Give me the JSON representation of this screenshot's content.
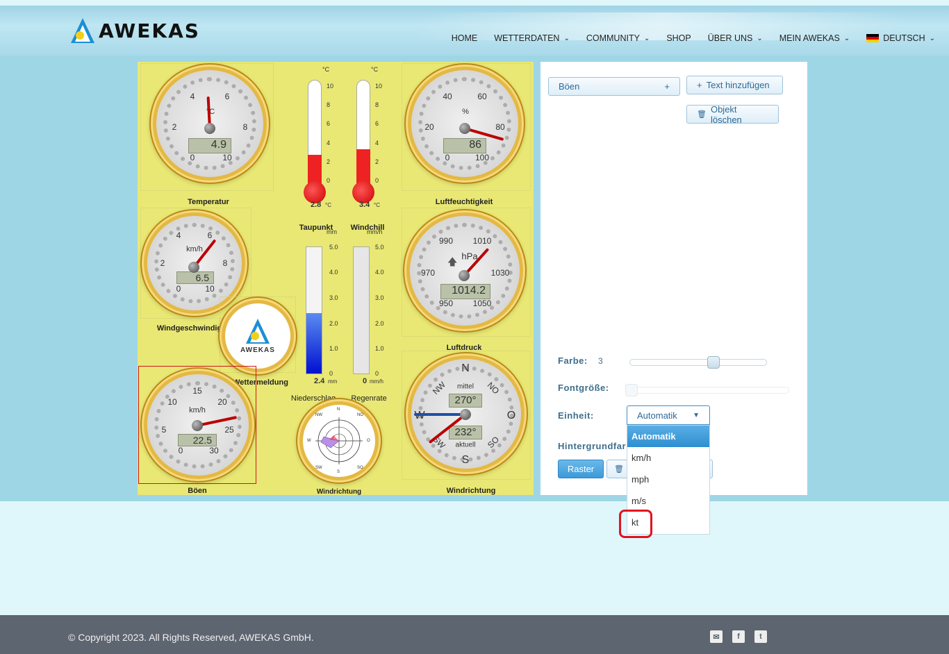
{
  "header": {
    "logo_text": "AWEKAS",
    "nav": [
      {
        "label": "HOME",
        "dropdown": false
      },
      {
        "label": "WETTERDATEN",
        "dropdown": true
      },
      {
        "label": "COMMUNITY",
        "dropdown": true
      },
      {
        "label": "SHOP",
        "dropdown": false
      },
      {
        "label": "ÜBER UNS",
        "dropdown": true
      },
      {
        "label": "MEIN AWEKAS",
        "dropdown": true
      },
      {
        "label": "DEUTSCH",
        "dropdown": true
      }
    ]
  },
  "gauges": {
    "temperatur": {
      "label": "Temperatur",
      "unit": "°C",
      "value": "4.9",
      "scale": [
        "0",
        "2",
        "4",
        "6",
        "8",
        "10"
      ]
    },
    "taupunkt": {
      "label": "Taupunkt",
      "unit": "°C",
      "value": "2.8",
      "value_unit": "°C",
      "scale": [
        "10",
        "8",
        "6",
        "4",
        "2",
        "0"
      ]
    },
    "windchill": {
      "label": "Windchill",
      "unit": "°C",
      "value": "3.4",
      "value_unit": "°C",
      "scale": [
        "10",
        "8",
        "6",
        "4",
        "2",
        "0"
      ]
    },
    "luftfeuchtigkeit": {
      "label": "Luftfeuchtigkeit",
      "unit": "%",
      "value": "86",
      "scale": [
        "0",
        "20",
        "40",
        "60",
        "80",
        "100"
      ]
    },
    "windgeschwindigkeit": {
      "label": "Windgeschwindigkeit",
      "unit": "km/h",
      "value": "6.5",
      "scale": [
        "0",
        "2",
        "4",
        "6",
        "8",
        "10"
      ]
    },
    "wettermeldung": {
      "label": "Wettermeldung",
      "logo_text": "AWEKAS"
    },
    "niederschlag": {
      "label": "Niederschlag",
      "unit": "mm",
      "value": "2.4",
      "value_unit": "mm",
      "scale": [
        "5.0",
        "4.0",
        "3.0",
        "2.0",
        "1.0",
        "0"
      ]
    },
    "regenrate": {
      "label": "Regenrate",
      "unit": "mm/h",
      "value": "0",
      "value_unit": "mm/h",
      "scale": [
        "5.0",
        "4.0",
        "3.0",
        "2.0",
        "1.0",
        "0"
      ]
    },
    "luftdruck": {
      "label": "Luftdruck",
      "unit": "hPa",
      "value": "1014.2",
      "scale": [
        "950",
        "970",
        "990",
        "1010",
        "1030",
        "1050"
      ]
    },
    "boeen": {
      "label": "Böen",
      "unit": "km/h",
      "value": "22.5",
      "scale": [
        "0",
        "5",
        "10",
        "15",
        "20",
        "25",
        "30"
      ]
    },
    "windrose": {
      "label": "Windrichtung",
      "dirs": [
        "N",
        "NO",
        "O",
        "SO",
        "S",
        "SW",
        "W",
        "NW"
      ]
    },
    "windrichtung": {
      "label": "Windrichtung",
      "top_label": "mittel",
      "mean": "270°",
      "current": "232°",
      "bottom_label": "aktuell",
      "dirs": [
        "N",
        "NO",
        "O",
        "SO",
        "S",
        "SW",
        "W",
        "NW"
      ]
    }
  },
  "editor": {
    "element_select": "Böen",
    "add_text": "Text hinzufügen",
    "delete_object": "Objekt löschen",
    "farbe_label": "Farbe:",
    "farbe_value": "3",
    "farbe_level": 0.6,
    "fontgroesse_label": "Fontgröße:",
    "fontgroesse_level": 0.0,
    "einheit_label": "Einheit:",
    "einheit_value": "Automatik",
    "einheit_options": [
      "Automatik",
      "km/h",
      "mph",
      "m/s",
      "kt"
    ],
    "hintergrund_label": "Hintergrundfar",
    "raster_button": "Raster"
  },
  "footer": {
    "copyright": "© Copyright 2023. All Rights Reserved, AWEKAS GmbH."
  }
}
